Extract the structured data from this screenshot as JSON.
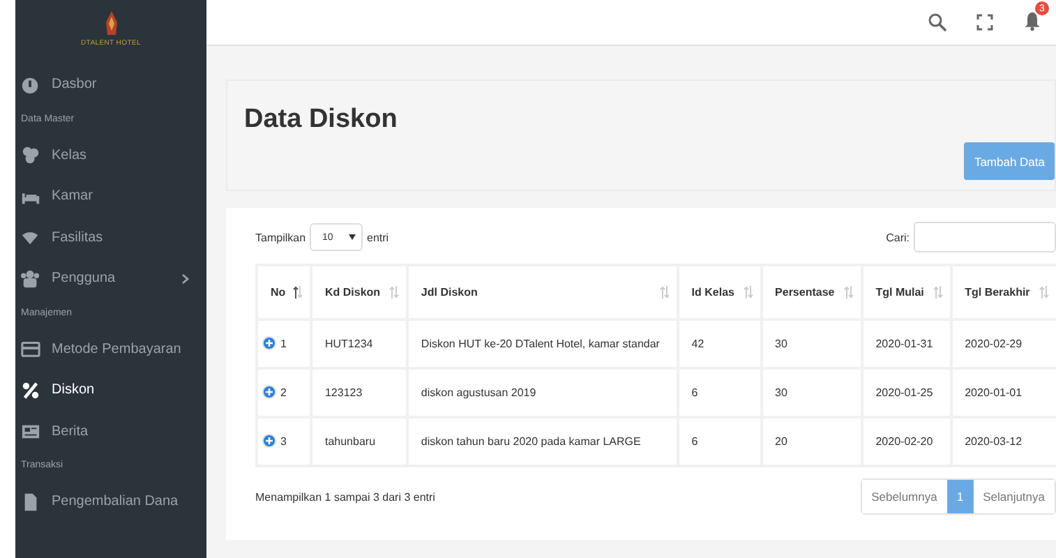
{
  "sidebar": {
    "logo_text": "DTALENT HOTEL",
    "items": [
      {
        "kind": "item",
        "label": "Dasbor",
        "selected": false,
        "has_children": false
      },
      {
        "kind": "section",
        "label": "Data Master"
      },
      {
        "kind": "item",
        "label": "Kelas",
        "selected": false,
        "has_children": false
      },
      {
        "kind": "item",
        "label": "Kamar",
        "selected": false,
        "has_children": false
      },
      {
        "kind": "item",
        "label": "Fasilitas",
        "selected": false,
        "has_children": false
      },
      {
        "kind": "item",
        "label": "Pengguna",
        "selected": false,
        "has_children": true
      },
      {
        "kind": "section",
        "label": "Manajemen"
      },
      {
        "kind": "item",
        "label": "Metode Pembayaran",
        "selected": false,
        "has_children": false
      },
      {
        "kind": "item",
        "label": "Diskon",
        "selected": true,
        "has_children": false
      },
      {
        "kind": "item",
        "label": "Berita",
        "selected": false,
        "has_children": false
      },
      {
        "kind": "section",
        "label": "Transaksi"
      },
      {
        "kind": "item",
        "label": "Pengembalian Dana",
        "selected": false,
        "has_children": false
      }
    ]
  },
  "topbar": {
    "notification_count": "3"
  },
  "page": {
    "title": "Data Diskon",
    "add_button": "Tambah Data"
  },
  "table_controls": {
    "show_label": "Tampilkan",
    "page_size": "10",
    "entries_label": "entri",
    "search_label": "Cari:"
  },
  "table": {
    "columns": [
      {
        "label": "No",
        "sorted": true
      },
      {
        "label": "Kd Diskon",
        "sorted": false
      },
      {
        "label": "Jdl Diskon",
        "sorted": false
      },
      {
        "label": "Id Kelas",
        "sorted": false
      },
      {
        "label": "Persentase",
        "sorted": false
      },
      {
        "label": "Tgl Mulai",
        "sorted": false
      },
      {
        "label": "Tgl Berakhir",
        "sorted": false
      }
    ],
    "rows": [
      [
        "1",
        "HUT1234",
        "Diskon HUT ke-20 DTalent Hotel, kamar standar",
        "42",
        "30",
        "2020-01-31",
        "2020-02-29"
      ],
      [
        "2",
        "123123",
        "diskon agustusan 2019",
        "6",
        "30",
        "2020-01-25",
        "2020-01-01"
      ],
      [
        "3",
        "tahunbaru",
        "diskon tahun baru 2020 pada kamar LARGE",
        "6",
        "20",
        "2020-02-20",
        "2020-03-12"
      ]
    ]
  },
  "footer": {
    "info": "Menampilkan 1 sampai 3 dari 3 entri",
    "pagination": [
      {
        "label": "Sebelumnya",
        "selected": false
      },
      {
        "label": "1",
        "selected": true
      },
      {
        "label": "Selanjutnya",
        "selected": false
      }
    ]
  }
}
